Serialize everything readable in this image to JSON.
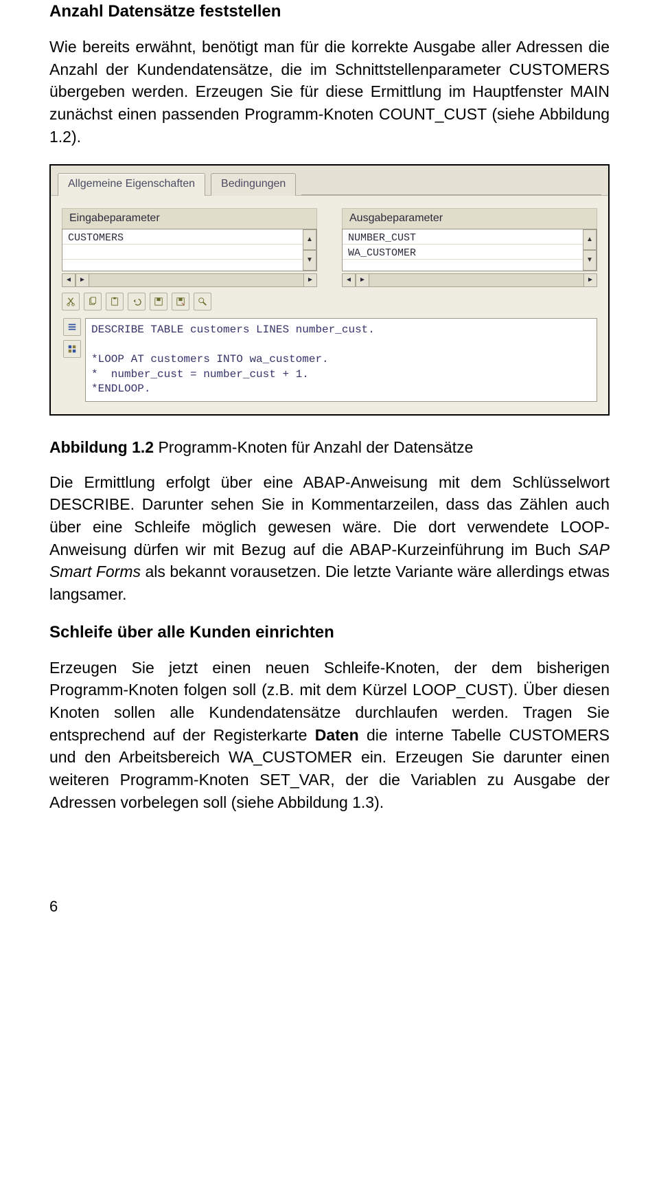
{
  "h1": "Anzahl Datensätze feststellen",
  "p1_a": "Wie bereits erwähnt, benötigt man für die korrekte Ausgabe aller Adressen die Anzahl der Kundendatensätze, die im Schnittstellenparameter CUSTOMERS übergeben werden. Erzeugen Sie für diese Ermittlung im Hauptfenster MAIN zunächst einen passenden Programm-Knoten COUNT_CUST (siehe Abbildung 1.2).",
  "sap": {
    "tabs": {
      "general": "Allgemeine Eigenschaften",
      "conditions": "Bedingungen"
    },
    "eingabe_label": "Eingabeparameter",
    "ausgabe_label": "Ausgabeparameter",
    "eingabe": {
      "row1": "CUSTOMERS",
      "row2": ""
    },
    "ausgabe": {
      "row1": "NUMBER_CUST",
      "row2": "WA_CUSTOMER"
    },
    "code": {
      "l1": "DESCRIBE TABLE customers LINES number_cust.",
      "l2": "",
      "l3": "*LOOP AT customers INTO wa_customer.",
      "l4": "*  number_cust = number_cust + 1.",
      "l5": "*ENDLOOP."
    }
  },
  "caption_num": "Abbildung 1.2",
  "caption_text": " Programm-Knoten für Anzahl der Datensätze",
  "p2_a": "Die Ermittlung erfolgt über eine ABAP-Anweisung mit dem Schlüsselwort DESCRIBE. Darunter sehen Sie in Kommentarzeilen, dass das Zählen auch über eine Schleife möglich gewesen wäre. Die dort verwendete LOOP-Anweisung dürfen wir mit Bezug auf die ABAP-Kurzeinführung im Buch ",
  "p2_em": "SAP Smart Forms",
  "p2_b": " als bekannt vorausetzen. Die letzte Variante wäre allerdings etwas langsamer.",
  "h2": "Schleife über alle Kunden einrichten",
  "p3_a": "Erzeugen Sie jetzt einen neuen Schleife-Knoten, der dem bisherigen Programm-Knoten folgen soll (z.B. mit dem Kürzel LOOP_CUST). Über diesen Knoten sollen alle Kundendatensätze durchlaufen werden. Tragen Sie entsprechend auf der Registerkarte ",
  "p3_bold": "Daten",
  "p3_b": " die interne Tabelle CUSTOMERS und den Arbeitsbereich WA_CUSTOMER ein. Erzeugen Sie darunter einen weiteren Programm-Knoten SET_VAR, der die Variablen zu Ausgabe der Adressen vorbelegen soll (siehe Abbildung 1.3).",
  "pagenum": "6"
}
